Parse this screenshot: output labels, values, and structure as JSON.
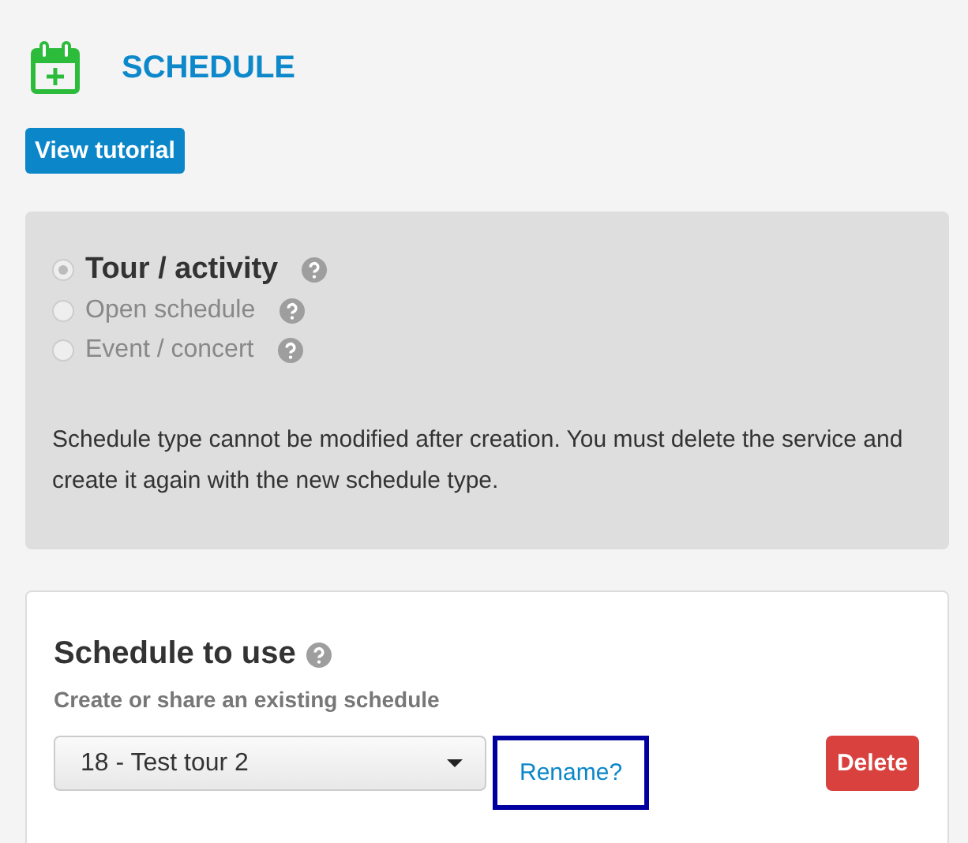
{
  "header": {
    "title": "SCHEDULE",
    "tutorial_button": "View tutorial"
  },
  "schedule_type": {
    "options": [
      {
        "label": "Tour / activity",
        "selected": true
      },
      {
        "label": "Open schedule",
        "selected": false
      },
      {
        "label": "Event / concert",
        "selected": false
      }
    ],
    "note": "Schedule type cannot be modified after creation. You must delete the service and create it again with the new schedule type."
  },
  "schedule_to_use": {
    "title": "Schedule to use",
    "subtitle": "Create or share an existing schedule",
    "select_value": "18 - Test tour 2",
    "rename_link": {
      "label": "Rename?",
      "focused": true
    },
    "delete_button": "Delete"
  }
}
